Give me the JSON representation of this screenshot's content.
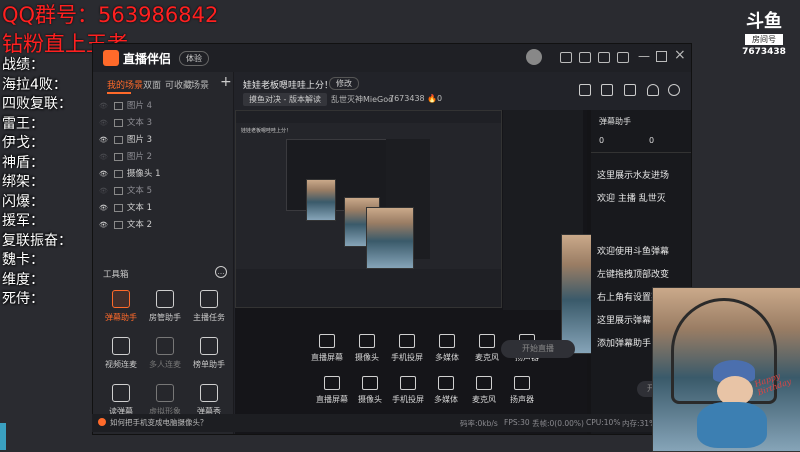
{
  "overlay": {
    "qq_group": "QQ群号：563986842",
    "subtitle": "钻粉直上王者",
    "lines": [
      "战绩：",
      "海拉4败：",
      "四败复联：",
      "雷王：",
      "伊戈：",
      "神盾：",
      "绑架：",
      "闪爆：",
      "援军：",
      "复联振奋：",
      "魏卡：",
      "维度：",
      "死侍："
    ]
  },
  "douyu": {
    "logo_text": "斗鱼",
    "room_label": "房间号",
    "room_number": "7673438"
  },
  "app": {
    "name": "直播伴侣",
    "badge": "体验",
    "sidebar_tabs": [
      "我的场景",
      "双面",
      "可收藏",
      "场景"
    ],
    "layers": [
      "图片 4",
      "文本 3",
      "图片 3",
      "图片 2",
      "摄像头 1",
      "文本 5",
      "文本 1",
      "文本 2"
    ],
    "toolbox_title": "工具箱",
    "tools": [
      "弹幕助手",
      "房管助手",
      "主播任务",
      "视频连麦",
      "多人连麦",
      "榜单助手",
      "读弹幕",
      "虚拟形象",
      "弹幕秀"
    ],
    "bottom_hint": "如何把手机变成电脑摄像头？"
  },
  "stream": {
    "title": "娃娃老板嗯哇哇上分！",
    "edit_label": "修改",
    "category": "摸鱼对决 - 版本解读",
    "streamer": "乱世灭神MieGod",
    "room_id": "7673438",
    "heat": "0"
  },
  "controls": {
    "buttons": [
      "直播屏幕",
      "摄像头",
      "手机投屏",
      "多媒体",
      "麦克风",
      "扬声器"
    ],
    "start_label": "开始直播"
  },
  "chat": {
    "title": "弹幕助手",
    "counts": [
      "0",
      "0"
    ],
    "messages": [
      "这里展示水友进场",
      "欢迎 主播 乱世灭",
      "欢迎使用斗鱼弹幕",
      "左键拖拽顶部改变",
      "右上角有设置菜单",
      "这里展示弹幕",
      "添加弹幕助手"
    ]
  },
  "status": {
    "bitrate": "码率:0kb/s",
    "fps": "FPS:30",
    "drop": "丢帧:0(0.00%)",
    "cpu": "CPU:10%",
    "mem": "内存:31%"
  },
  "photo_text": "Happy Birthday"
}
